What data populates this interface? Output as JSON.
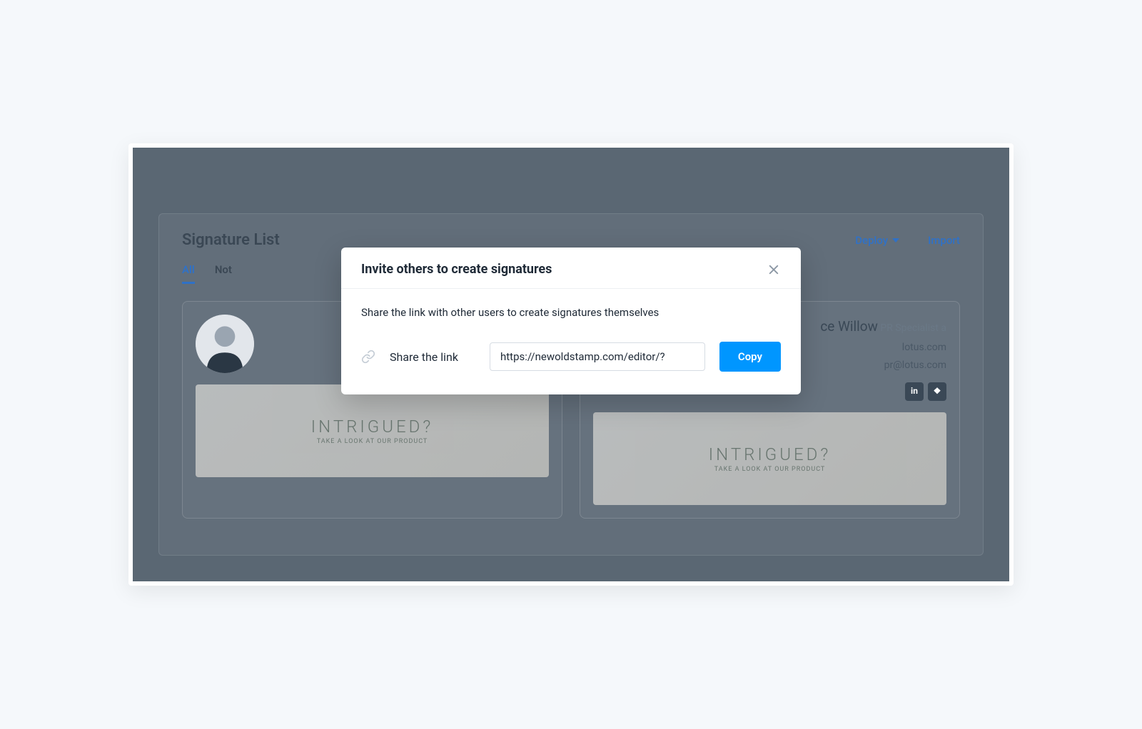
{
  "page": {
    "title": "Signature List",
    "deploy_label": "Deploy",
    "import_label": "Import"
  },
  "tabs": {
    "all": "All",
    "not": "Not"
  },
  "cards": [
    {
      "name": "",
      "role": "",
      "website": "",
      "email": "",
      "banner_title": "INTRIGUED?",
      "banner_sub": "TAKE A LOOK AT OUR PRODUCT"
    },
    {
      "name": "ce Willow",
      "role": "PR Specialist a",
      "website": "lotus.com",
      "email": "pr@lotus.com",
      "banner_title": "INTRIGUED?",
      "banner_sub": "TAKE A LOOK AT OUR PRODUCT"
    }
  ],
  "modal": {
    "title": "Invite others to create signatures",
    "description": "Share the link with other users to create signatures themselves",
    "share_label": "Share the link",
    "link_value": "https://newoldstamp.com/editor/?",
    "copy_label": "Copy"
  }
}
